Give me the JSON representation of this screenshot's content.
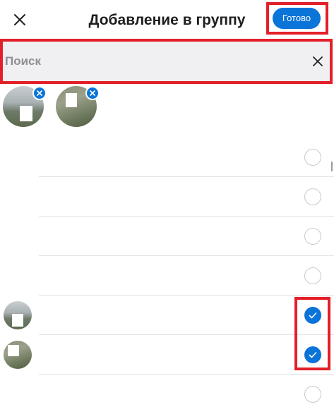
{
  "header": {
    "title": "Добавление в группу",
    "done_label": "Готово",
    "close_icon": "close-icon"
  },
  "search": {
    "placeholder": "Поиск",
    "value": "",
    "clear_icon": "clear-icon"
  },
  "selected_contacts": [
    {
      "avatar": "photo",
      "remove_icon": "remove-icon"
    },
    {
      "avatar": "photo",
      "remove_icon": "remove-icon"
    }
  ],
  "contacts": [
    {
      "checked": false,
      "avatar": "none"
    },
    {
      "checked": false,
      "avatar": "none"
    },
    {
      "checked": false,
      "avatar": "none"
    },
    {
      "checked": false,
      "avatar": "none"
    },
    {
      "checked": true,
      "avatar": "photo"
    },
    {
      "checked": true,
      "avatar": "photo"
    },
    {
      "checked": false,
      "avatar": "none"
    }
  ],
  "colors": {
    "accent": "#0a74d8",
    "highlight": "#e3202a",
    "search_bg": "#f0f0f2"
  }
}
